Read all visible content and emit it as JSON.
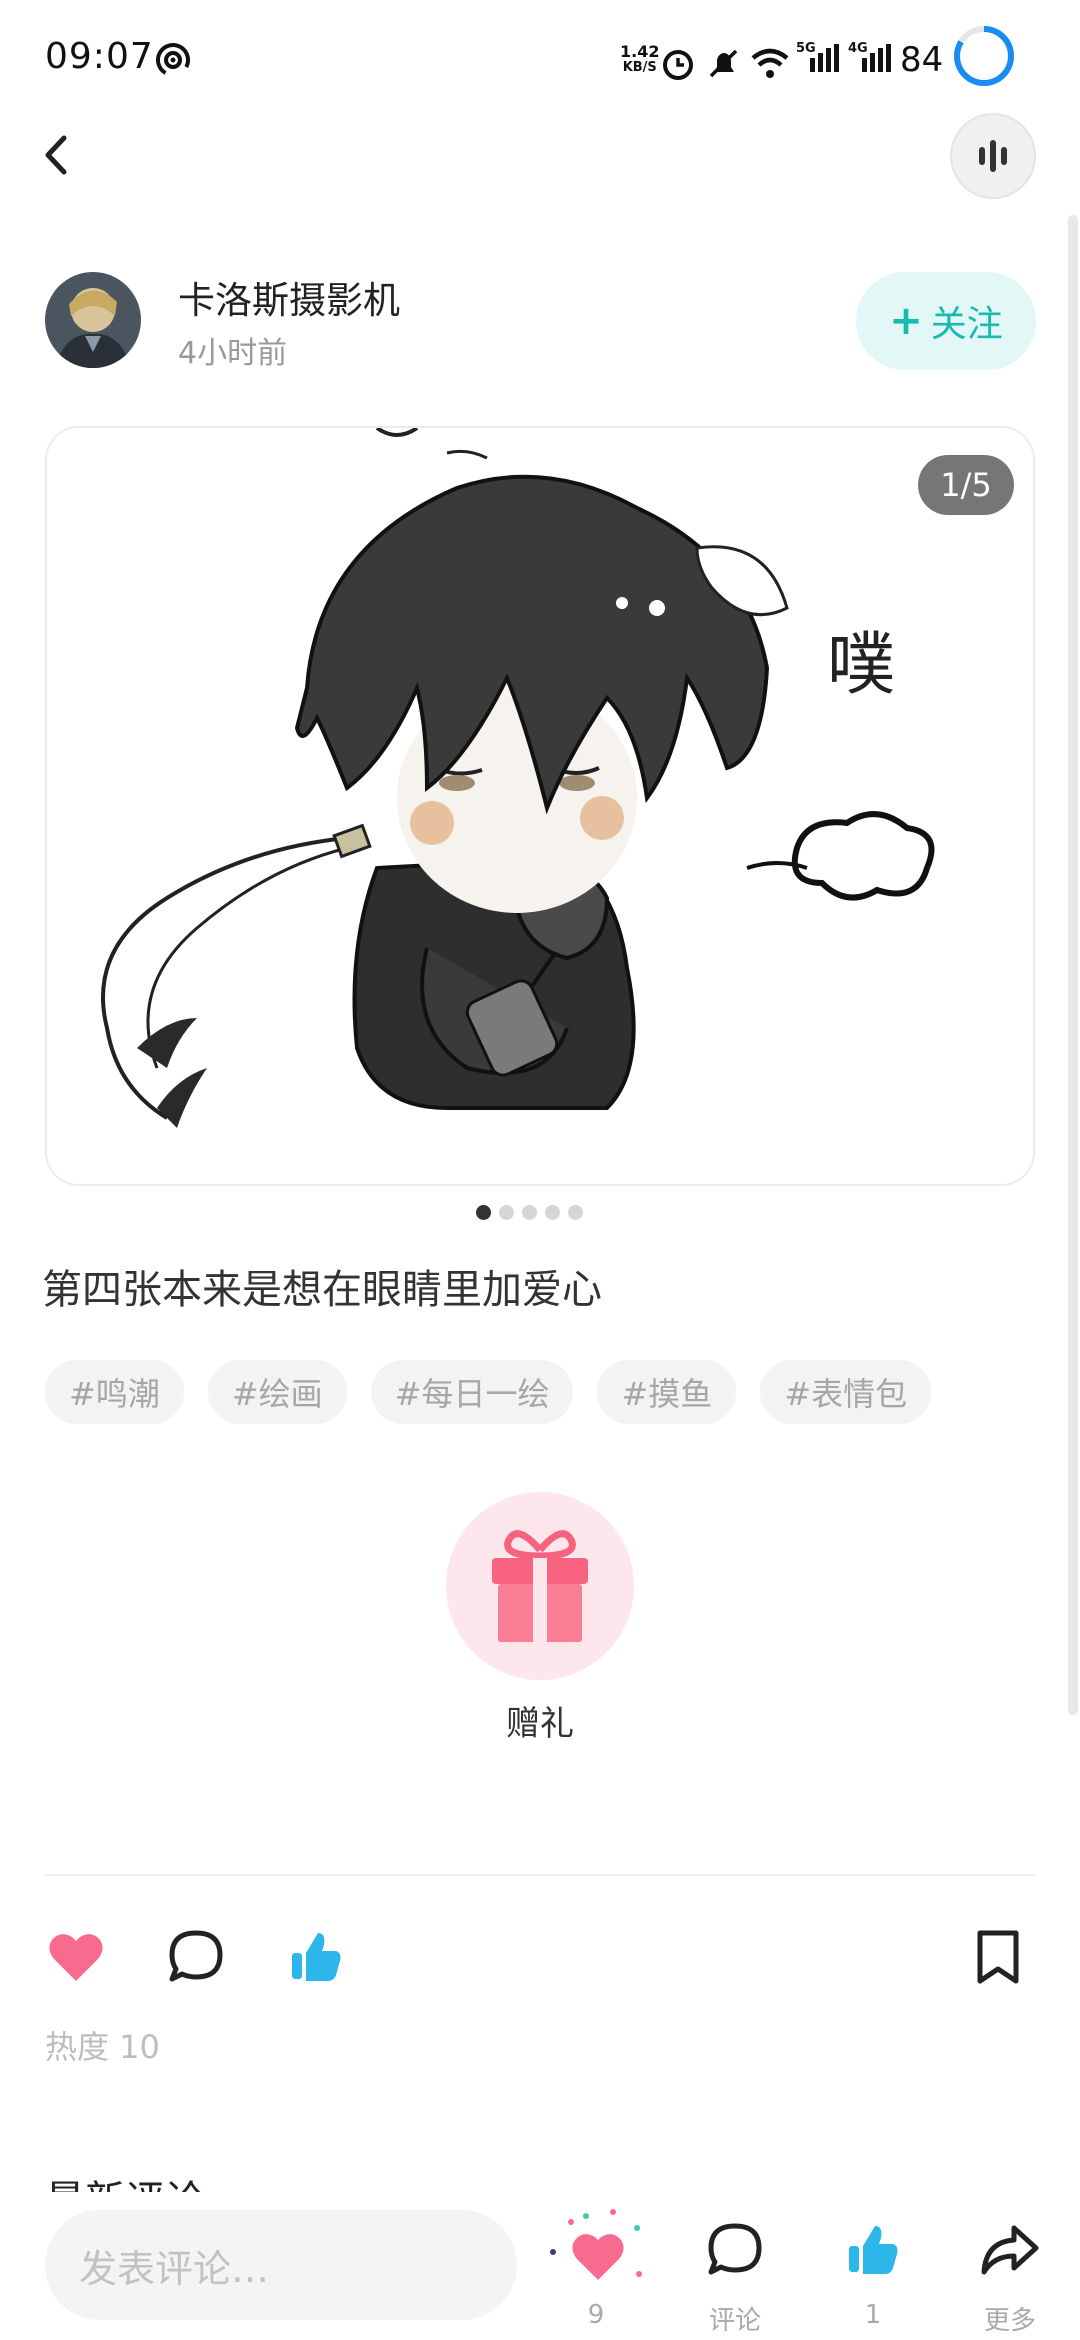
{
  "status_bar": {
    "time": "09:07",
    "net_speed_value": "1.42",
    "net_speed_unit": "KB/S",
    "signal_1_label": "5G",
    "signal_2_label": "4G",
    "battery": "84"
  },
  "author": {
    "name": "卡洛斯摄影机",
    "time": "4小时前",
    "follow_label": "关注",
    "follow_plus": "+"
  },
  "image_viewer": {
    "counter": "1/5",
    "sticker_text": "噗",
    "current_index": 1,
    "total": 5
  },
  "post": {
    "text": "第四张本来是想在眼睛里加爱心",
    "tags": [
      "#鸣潮",
      "#绘画",
      "#每日一绘",
      "#摸鱼",
      "#表情包"
    ]
  },
  "gift": {
    "label": "赠礼"
  },
  "stats": {
    "heat": "热度 10"
  },
  "comments": {
    "section_title": "最新评论"
  },
  "bottom_bar": {
    "input_placeholder": "发表评论…",
    "like_count": "9",
    "comment_label": "评论",
    "thumb_count": "1",
    "more_label": "更多"
  },
  "colors": {
    "accent_teal": "#1ab9b0",
    "like_pink": "#f96a8f",
    "thumb_blue": "#2db6ea",
    "gift_red": "#f7637e"
  },
  "icons": [
    "hotspot-icon",
    "alarm-icon",
    "mute-icon",
    "wifi-icon",
    "signal-icon",
    "back-icon",
    "audio-icon",
    "heart-icon",
    "comment-icon",
    "thumb-up-icon",
    "bookmark-icon",
    "share-icon",
    "gift-icon"
  ]
}
